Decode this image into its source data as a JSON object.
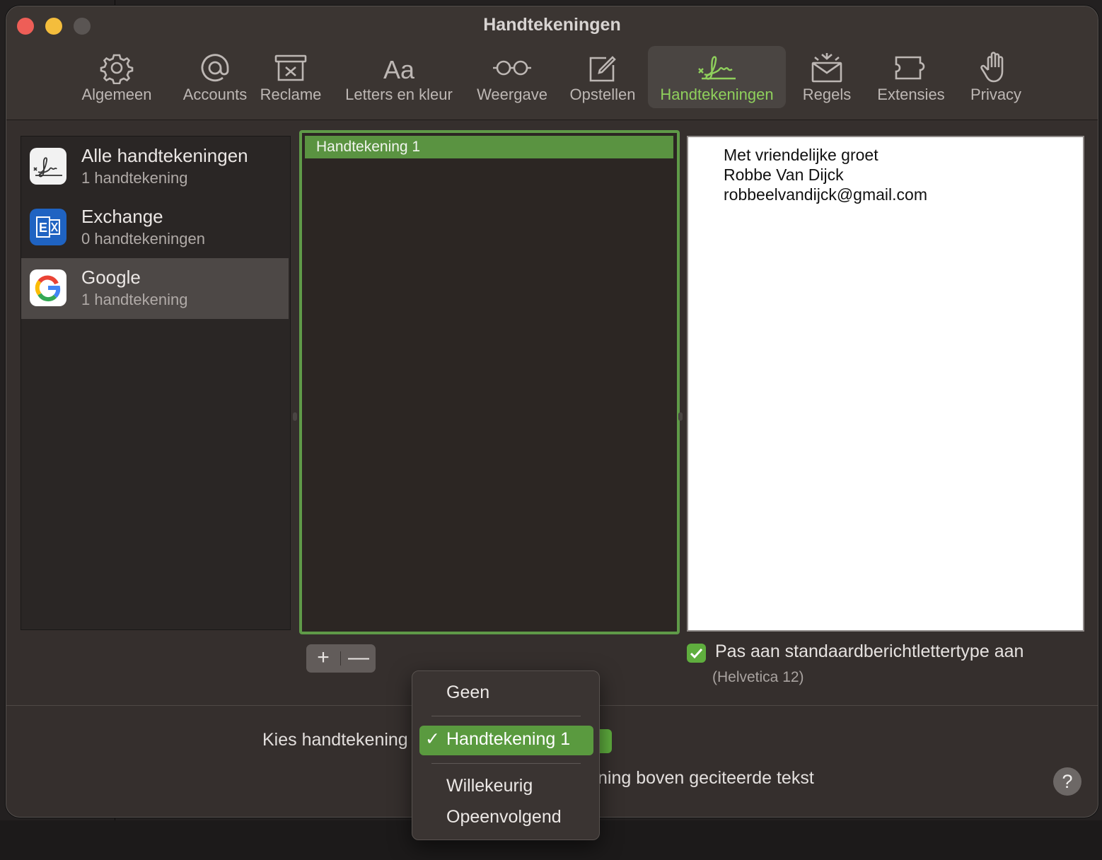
{
  "window": {
    "title": "Handtekeningen"
  },
  "toolbar": {
    "items": [
      {
        "label": "Algemeen",
        "icon": "gear-icon"
      },
      {
        "label": "Accounts",
        "icon": "at-icon"
      },
      {
        "label": "Reclame",
        "icon": "junk-box-icon"
      },
      {
        "label": "Letters en kleur",
        "icon": "fonts-icon"
      },
      {
        "label": "Weergave",
        "icon": "glasses-icon"
      },
      {
        "label": "Opstellen",
        "icon": "compose-icon"
      },
      {
        "label": "Handtekeningen",
        "icon": "signature-icon",
        "active": true
      },
      {
        "label": "Regels",
        "icon": "rules-envelope-icon"
      },
      {
        "label": "Extensies",
        "icon": "puzzle-icon"
      },
      {
        "label": "Privacy",
        "icon": "hand-icon"
      }
    ]
  },
  "accounts": [
    {
      "name": "Alle handtekeningen",
      "count": "1 handtekening",
      "icon": "signature-app-icon"
    },
    {
      "name": "Exchange",
      "count": "0 handtekeningen",
      "icon": "exchange-icon"
    },
    {
      "name": "Google",
      "count": "1 handtekening",
      "icon": "google-icon",
      "selected": true
    }
  ],
  "signatures": {
    "items": [
      "Handtekening 1"
    ],
    "add_label": "+",
    "remove_label": "—"
  },
  "preview": {
    "lines": [
      "Met vriendelijke groet",
      "Robbe Van Dijck",
      "robbeelvandijck@gmail.com"
    ]
  },
  "font_option": {
    "label": "Pas aan standaardberichtlettertype aan",
    "checked": true,
    "font": "(Helvetica 12)"
  },
  "bottom": {
    "choose_label": "Kies handtekening:",
    "choose_label_visible": "Kies handtekening",
    "quoted_label_visible": "ning boven geciteerde tekst",
    "help_label": "?"
  },
  "menu": {
    "items": [
      "Geen",
      "Handtekening 1",
      "Willekeurig",
      "Opeenvolgend"
    ],
    "selected": "Handtekening 1",
    "check": "✓"
  },
  "colors": {
    "accent": "#5a9a3f",
    "accent_text": "#8fd05c",
    "window_bg": "#352f2d"
  }
}
